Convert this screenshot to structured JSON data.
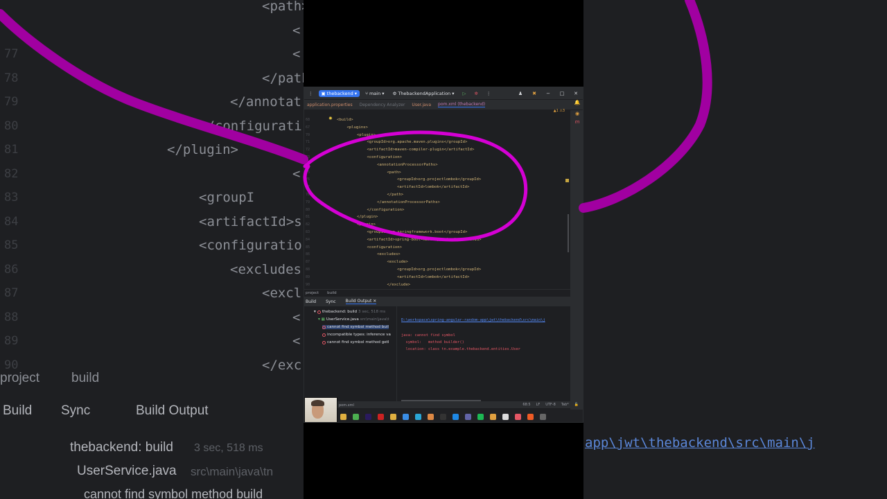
{
  "background_zoom": {
    "left_code_lines": [
      "<path>",
      "<",
      "<",
      "</path",
      "</annotat",
      "</configurati",
      "</plugin>",
      "<",
      "<groupI",
      "<artifactId>s",
      "<configuratio",
      "<excludes",
      "<excl",
      "<",
      "<",
      "</exc"
    ],
    "left_line_numbers": [
      "77",
      "78",
      "79",
      "80",
      "81",
      "82",
      "83",
      "84",
      "85",
      "86",
      "87",
      "88",
      "89",
      "90"
    ],
    "breadcrumb": [
      "project",
      "build"
    ],
    "build_tabs": [
      "Build",
      "Sync",
      "Build Output"
    ],
    "tree": [
      {
        "label": "thebackend: build",
        "meta": "3 sec, 518 ms"
      },
      {
        "label": "UserService.java",
        "meta": "src\\main\\java\\tn"
      },
      {
        "label": "cannot find symbol method build"
      }
    ],
    "right_link": "app\\jwt\\thebackend\\src\\main\\j"
  },
  "titlebar": {
    "project": "thebackend",
    "branch": "main",
    "run_config": "ThebackendApplication"
  },
  "tabs": [
    {
      "label": "application.properties",
      "state": "normal"
    },
    {
      "label": "Dependency Analyzer",
      "state": "dim"
    },
    {
      "label": "User.java",
      "state": "normal"
    },
    {
      "label": "pom.xml (thebackend)",
      "state": "active"
    }
  ],
  "inspections": "▲1 ⚠3",
  "editor": {
    "line_numbers": [
      "68",
      "67",
      "70",
      "71",
      "72",
      "73",
      "74",
      "75",
      "76",
      "77",
      "78",
      "79",
      "80",
      "81",
      "82",
      "83",
      "84",
      "85",
      "86",
      "87",
      "88",
      "89",
      "90"
    ],
    "lines": [
      {
        "indent": 0,
        "text": "<build>"
      },
      {
        "indent": 1,
        "text": "<plugins>"
      },
      {
        "indent": 2,
        "text": "<plugin>"
      },
      {
        "indent": 3,
        "text": "<groupId>org.apache.maven.plugins</groupId>"
      },
      {
        "indent": 3,
        "text": "<artifactId>maven-compiler-plugin</artifactId>"
      },
      {
        "indent": 3,
        "text": "<configuration>"
      },
      {
        "indent": 4,
        "text": "<annotationProcessorPaths>"
      },
      {
        "indent": 5,
        "text": "<path>"
      },
      {
        "indent": 6,
        "text": "<groupId>org.projectlombok</groupId>"
      },
      {
        "indent": 6,
        "text": "<artifactId>lombok</artifactId>"
      },
      {
        "indent": 5,
        "text": "</path>"
      },
      {
        "indent": 4,
        "text": "</annotationProcessorPaths>"
      },
      {
        "indent": 3,
        "text": "</configuration>"
      },
      {
        "indent": 2,
        "text": "</plugin>"
      },
      {
        "indent": 2,
        "text": "<plugin>"
      },
      {
        "indent": 3,
        "text": "<groupId>org.springframework.boot</groupId>"
      },
      {
        "indent": 3,
        "text": "<artifactId>spring-boot-maven-plugin</artifactId>"
      },
      {
        "indent": 3,
        "text": "<configuration>"
      },
      {
        "indent": 4,
        "text": "<excludes>"
      },
      {
        "indent": 5,
        "text": "<exclude>"
      },
      {
        "indent": 6,
        "text": "<groupId>org.projectlombok</groupId>"
      },
      {
        "indent": 6,
        "text": "<artifactId>lombok</artifactId>"
      },
      {
        "indent": 5,
        "text": "</exclude>"
      }
    ]
  },
  "breadcrumb": [
    "project",
    "build"
  ],
  "build_tabs": [
    "Build",
    "Sync",
    "Build Output"
  ],
  "build_tree": [
    {
      "label": "thebackend: build",
      "meta": "3 sec, 518 ms",
      "level": 0
    },
    {
      "label": "UserService.java",
      "meta": "src\\main\\java\\t",
      "level": 1
    },
    {
      "label": "cannot find symbol method buil",
      "level": 2,
      "selected": true
    },
    {
      "label": "incompatible types: inference va",
      "level": 2
    },
    {
      "label": "cannot find symbol method getI",
      "level": 2
    }
  ],
  "build_output": {
    "path": "D:\\workspace\\spring-angular-random-app\\jwt\\thebackend\\src\\main\\j",
    "lines": [
      "java: cannot find symbol",
      "  symbol:   method builder()",
      "  location: class tn.example.thebackend.entities.User"
    ]
  },
  "status": {
    "position": "68:5",
    "line_ending": "LF",
    "encoding": "UTF-8",
    "indent": "Tab*"
  },
  "taskbar_file": "pom.xml",
  "colors": {
    "annotation": "#d400d4",
    "accent": "#3574f0",
    "error": "#e55765"
  }
}
